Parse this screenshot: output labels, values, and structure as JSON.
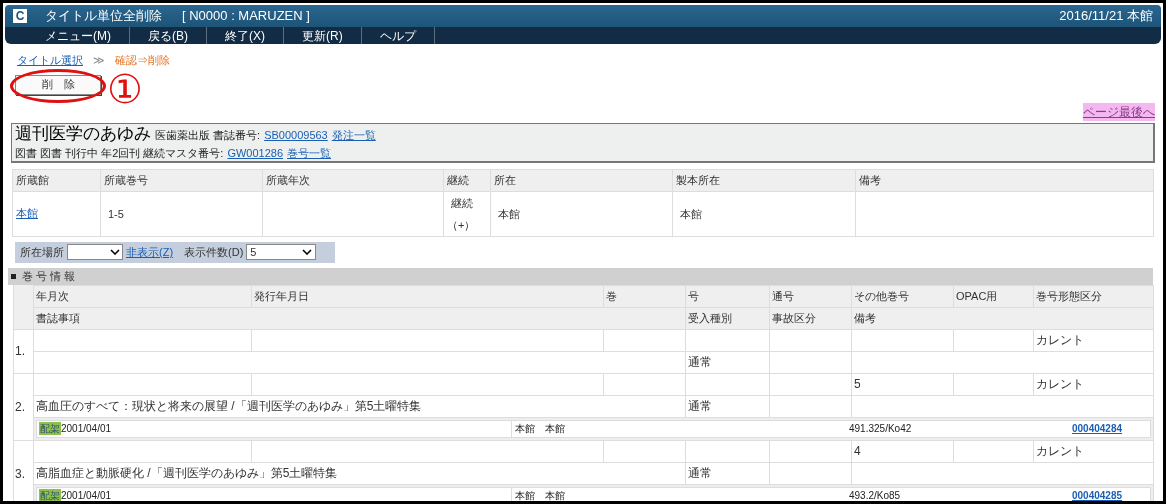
{
  "window": {
    "logo": "C",
    "title": "タイトル単位全削除",
    "context": "[ N0000 : MARUZEN ]",
    "date_branch": "2016/11/21 本館"
  },
  "menu": [
    {
      "label": "メニュー(M)"
    },
    {
      "label": "戻る(B)"
    },
    {
      "label": "終了(X)"
    },
    {
      "label": "更新(R)"
    },
    {
      "label": "ヘルプ"
    }
  ],
  "breadcrumb": {
    "link": "タイトル選択",
    "separator": "≫",
    "current": "確認⇒削除"
  },
  "delete_button": "削　除",
  "annotations": [
    {
      "kind": "ellipse"
    },
    {
      "kind": "number",
      "text": "①"
    }
  ],
  "page_end_link": "ページ最後へ",
  "title_box": {
    "title": "週刊医学のあゆみ",
    "line1": [
      {
        "kind": "text",
        "text": "医歯薬出版 書誌番号:"
      },
      {
        "kind": "link",
        "text": "SB00009563"
      },
      {
        "kind": "link",
        "text": "発注一覧"
      }
    ],
    "line2": [
      {
        "kind": "text",
        "text": "図書 図書 刊行中 年2回刊 継続マスタ番号:"
      },
      {
        "kind": "link",
        "text": "GW001286"
      },
      {
        "kind": "link",
        "text": "巻号一覧"
      }
    ]
  },
  "holdings": {
    "columns": [
      "所蔵館",
      "所蔵巻号",
      "所蔵年次",
      "継続",
      "所在",
      "製本所在",
      "備考"
    ],
    "rows": [
      [
        {
          "kind": "link",
          "text": "本館"
        },
        {
          "kind": "text",
          "text": "1-5"
        },
        {},
        {
          "kind": "text",
          "text": "継続（+）"
        },
        {
          "kind": "text",
          "text": "本館"
        },
        {
          "kind": "text",
          "text": "本館"
        },
        {}
      ]
    ]
  },
  "filter": {
    "location_label": "所在場所",
    "hide_link": "非表示(Z)",
    "count_label": "表示件数(D)",
    "count_value": "5"
  },
  "section": {
    "title": "巻 号 情 報"
  },
  "issues": {
    "columns_row1": [
      "年月次",
      "発行年月日",
      "巻",
      "号",
      "通号",
      "その他巻号",
      "OPAC用",
      "巻号形態区分"
    ],
    "columns_row2": [
      "書誌事項",
      "受入種別",
      "事故区分",
      "備考"
    ],
    "rows": [
      {
        "number": "1.",
        "form": "カレント",
        "acquisition": "通常",
        "copies": []
      },
      {
        "number": "2.",
        "other_volume": "5",
        "form": "カレント",
        "bib": "高血圧のすべて：現状と将来の展望 /「週刊医学のあゆみ」第5土曜特集",
        "acquisition": "通常",
        "copies": [
          {
            "status": "配架",
            "date": "2001/04/01",
            "location": "本館　本館",
            "call_number": "491.325/Ko42",
            "barcode": "000404284"
          }
        ]
      },
      {
        "number": "3.",
        "other_volume": "4",
        "form": "カレント",
        "bib": "高脂血症と動脈硬化 /「週刊医学のあゆみ」第5土曜特集",
        "acquisition": "通常",
        "copies": [
          {
            "status": "配架",
            "date": "2001/04/01",
            "location": "本館　本館",
            "call_number": "493.2/Ko85",
            "barcode": "000404285"
          }
        ]
      }
    ]
  }
}
